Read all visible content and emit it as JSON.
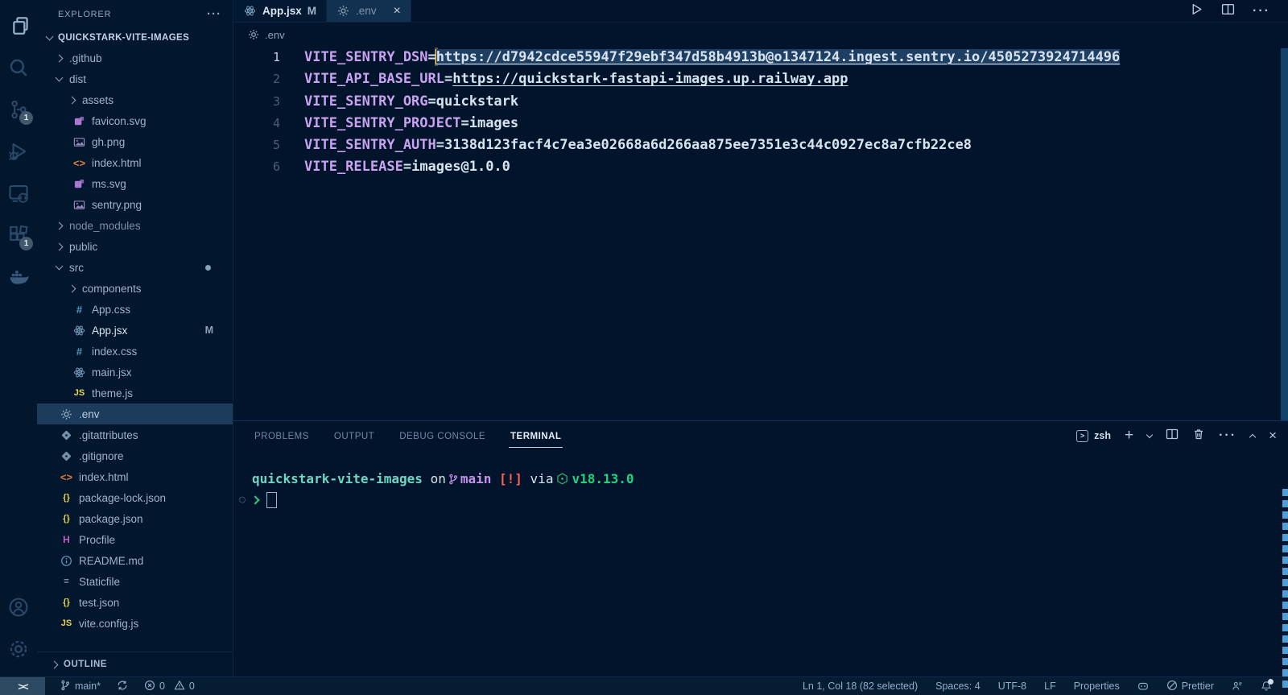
{
  "accent": {
    "selection": "#1e3e62",
    "key_color": "#c9a3ef",
    "link_color": "#d8e3f0",
    "cursor_color": "#f2c55c",
    "scrollbar_color": "#12426a"
  },
  "activity_bar": {
    "items": [
      {
        "name": "explorer",
        "icon": "files-icon",
        "active": true
      },
      {
        "name": "search",
        "icon": "search-icon"
      },
      {
        "name": "source-control",
        "icon": "source-control-icon",
        "badge": "1"
      },
      {
        "name": "run-debug",
        "icon": "debug-icon"
      },
      {
        "name": "remote-explorer",
        "icon": "remote-explorer-icon"
      },
      {
        "name": "extensions",
        "icon": "extensions-icon",
        "badge": "1"
      },
      {
        "name": "docker",
        "icon": "docker-icon"
      }
    ],
    "bottom": [
      {
        "name": "account",
        "icon": "account-icon"
      },
      {
        "name": "settings",
        "icon": "gear-icon"
      }
    ]
  },
  "explorer": {
    "title": "EXPLORER",
    "root_label": "QUICKSTARK-VITE-IMAGES",
    "outline_label": "OUTLINE",
    "items": [
      {
        "label": ".github",
        "kind": "folder",
        "indent": 0,
        "expanded": false
      },
      {
        "label": "dist",
        "kind": "folder",
        "indent": 0,
        "expanded": true
      },
      {
        "label": "assets",
        "kind": "folder",
        "indent": 1,
        "expanded": false
      },
      {
        "label": "favicon.svg",
        "kind": "file",
        "indent": 1,
        "icon": "svg",
        "color": "#a678cf"
      },
      {
        "label": "gh.png",
        "kind": "file",
        "indent": 1,
        "icon": "image",
        "color": "#9687b7"
      },
      {
        "label": "index.html",
        "kind": "file",
        "indent": 1,
        "icon": "html",
        "color": "#e07b39"
      },
      {
        "label": "ms.svg",
        "kind": "file",
        "indent": 1,
        "icon": "svg",
        "color": "#a678cf"
      },
      {
        "label": "sentry.png",
        "kind": "file",
        "indent": 1,
        "icon": "image",
        "color": "#9687b7"
      },
      {
        "label": "node_modules",
        "kind": "folder",
        "indent": 0,
        "expanded": false,
        "dim": true
      },
      {
        "label": "public",
        "kind": "folder",
        "indent": 0,
        "expanded": false
      },
      {
        "label": "src",
        "kind": "folder",
        "indent": 0,
        "expanded": true,
        "right": "dot"
      },
      {
        "label": "components",
        "kind": "folder",
        "indent": 1,
        "expanded": false
      },
      {
        "label": "App.css",
        "kind": "file",
        "indent": 1,
        "icon": "css",
        "color": "#519aba"
      },
      {
        "label": "App.jsx",
        "kind": "file",
        "indent": 1,
        "icon": "react",
        "color": "#7da2c1",
        "right": "M",
        "bright": true
      },
      {
        "label": "index.css",
        "kind": "file",
        "indent": 1,
        "icon": "css",
        "color": "#519aba"
      },
      {
        "label": "main.jsx",
        "kind": "file",
        "indent": 1,
        "icon": "react",
        "color": "#7da2c1"
      },
      {
        "label": "theme.js",
        "kind": "file",
        "indent": 1,
        "icon": "js",
        "color": "#e8d44d"
      },
      {
        "label": ".env",
        "kind": "file",
        "indent": 0,
        "icon": "gear",
        "color": "#8ba4bd",
        "selected": true
      },
      {
        "label": ".gitattributes",
        "kind": "file",
        "indent": 0,
        "icon": "git",
        "color": "#8ba4bd"
      },
      {
        "label": ".gitignore",
        "kind": "file",
        "indent": 0,
        "icon": "git",
        "color": "#8ba4bd"
      },
      {
        "label": "index.html",
        "kind": "file",
        "indent": 0,
        "icon": "html",
        "color": "#e07b39"
      },
      {
        "label": "package-lock.json",
        "kind": "file",
        "indent": 0,
        "icon": "json",
        "color": "#e8d44d"
      },
      {
        "label": "package.json",
        "kind": "file",
        "indent": 0,
        "icon": "json",
        "color": "#e8d44d"
      },
      {
        "label": "Procfile",
        "kind": "file",
        "indent": 0,
        "icon": "heroku",
        "color": "#c45bc0"
      },
      {
        "label": "README.md",
        "kind": "file",
        "indent": 0,
        "icon": "info",
        "color": "#6796c4"
      },
      {
        "label": "Staticfile",
        "kind": "file",
        "indent": 0,
        "icon": "lines",
        "color": "#8ba4bd"
      },
      {
        "label": "test.json",
        "kind": "file",
        "indent": 0,
        "icon": "json",
        "color": "#e8d44d"
      },
      {
        "label": "vite.config.js",
        "kind": "file",
        "indent": 0,
        "icon": "js",
        "color": "#e8d44d"
      }
    ]
  },
  "editor_tabs": [
    {
      "label": "App.jsx",
      "icon": "react",
      "icon_color": "#7da2c1",
      "badge": "M",
      "active": false
    },
    {
      "label": ".env",
      "icon": "gear",
      "icon_color": "#8097ad",
      "close": true,
      "active": true
    }
  ],
  "editor_actions": {
    "run": "run-button",
    "split": "split-editor-button",
    "more": "···"
  },
  "breadcrumb": {
    "label": ".env"
  },
  "editor": {
    "lines": [
      {
        "num": "1",
        "key": "VITE_SENTRY_DSN",
        "value": "https://d7942cdce55947f29ebf347d58b4913b@o1347124.ingest.sentry.io/4505273924714496",
        "link": true,
        "selected": true,
        "cursor": true,
        "active": true
      },
      {
        "num": "2",
        "key": "VITE_API_BASE_URL",
        "value": "https://quickstark-fastapi-images.up.railway.app",
        "link": true
      },
      {
        "num": "3",
        "key": "VITE_SENTRY_ORG",
        "value": "quickstark"
      },
      {
        "num": "4",
        "key": "VITE_SENTRY_PROJECT",
        "value": "images"
      },
      {
        "num": "5",
        "key": "VITE_SENTRY_AUTH",
        "value": "3138d123facf4c7ea3e02668a6d266aa875ee7351e3c44c0927ec8a7cfb22ce8"
      },
      {
        "num": "6",
        "key": "VITE_RELEASE",
        "value": "images@1.0.0"
      }
    ]
  },
  "panel": {
    "tabs": [
      {
        "label": "PROBLEMS",
        "active": false
      },
      {
        "label": "OUTPUT",
        "active": false
      },
      {
        "label": "DEBUG CONSOLE",
        "active": false
      },
      {
        "label": "TERMINAL",
        "active": true
      }
    ],
    "shell_label": "zsh",
    "more_dots": "···",
    "close_x": "×",
    "terminal": {
      "dir": "quickstark-vite-images",
      "on_word": "on",
      "branch": "main",
      "dirty_flag": "[!]",
      "via_word": "via",
      "node_version": "v18.13.0",
      "decor_circle": "○"
    }
  },
  "status_bar": {
    "remote_glyph": "><",
    "branch": "main*",
    "errors": "0",
    "warnings": "0",
    "right": {
      "cursor_pos": "Ln 1, Col 18 (82 selected)",
      "spaces": "Spaces: 4",
      "encoding": "UTF-8",
      "eol": "LF",
      "language": "Properties",
      "formatter": "Prettier"
    }
  }
}
